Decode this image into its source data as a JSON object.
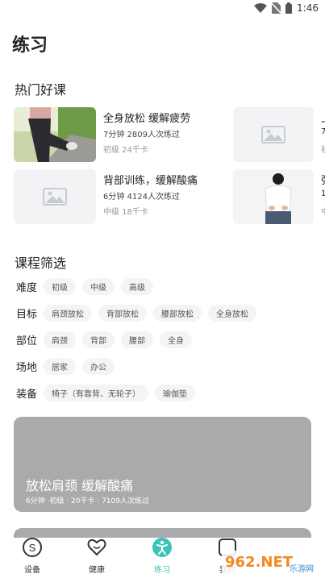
{
  "status_bar": {
    "time": "1:46"
  },
  "page_title": "练习",
  "hot_courses": {
    "title": "热门好课",
    "items": [
      {
        "title": "全身放松 缓解疲劳",
        "meta": "7分钟 2809人次练过",
        "level": "初级 24千卡",
        "thumb": "photo-runner-stretching"
      },
      {
        "title": "背部训练，缓解酸痛",
        "meta": "6分钟 4124人次练过",
        "level": "中级 18千卡",
        "thumb": "placeholder-image"
      }
    ],
    "partial_items": [
      {
        "thumb": "placeholder-image",
        "title_fragment": "上",
        "meta_fragment": "7",
        "level_fragment": "初"
      },
      {
        "thumb": "photo-back-pain",
        "title_fragment": "强",
        "meta_fragment": "1",
        "level_fragment": "中"
      }
    ]
  },
  "filter": {
    "title": "课程筛选",
    "rows": [
      {
        "label": "难度",
        "options": [
          "初级",
          "中级",
          "高级"
        ]
      },
      {
        "label": "目标",
        "options": [
          "肩颈放松",
          "背部放松",
          "腰部放松",
          "全身放松"
        ]
      },
      {
        "label": "部位",
        "options": [
          "肩颈",
          "背部",
          "腰部",
          "全身"
        ]
      },
      {
        "label": "场地",
        "options": [
          "居家",
          "办公"
        ]
      },
      {
        "label": "装备",
        "options": [
          "椅子（有靠背、无轮子）",
          "瑜伽垫"
        ]
      }
    ]
  },
  "banner": {
    "title": "放松肩颈 缓解酸痛",
    "meta": "6分钟 ·初级 · 20千卡 · 7109人次练过"
  },
  "tabs": [
    {
      "label": "设备",
      "icon": "device-s-icon",
      "active": false
    },
    {
      "label": "健康",
      "icon": "heart-icon",
      "active": false
    },
    {
      "label": "练习",
      "icon": "exercise-person-icon",
      "active": true
    },
    {
      "label": "我的",
      "icon": "profile-icon",
      "active": false
    }
  ],
  "watermark": {
    "text": "962.NET",
    "subtext": "乐游网"
  },
  "colors": {
    "accent": "#3cc3b5",
    "chip_bg": "#f3f4f6",
    "banner_bg": "#a9aaab"
  }
}
